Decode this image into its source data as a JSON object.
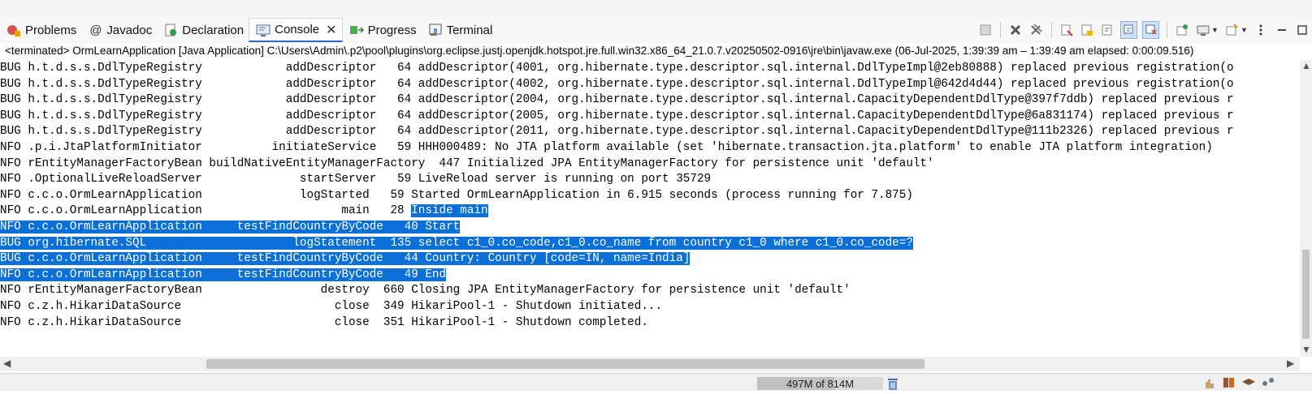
{
  "tabs": [
    {
      "label": "Problems",
      "icon": "problems-icon",
      "active": false
    },
    {
      "label": "Javadoc",
      "icon": "at-sign-icon",
      "active": false
    },
    {
      "label": "Declaration",
      "icon": "declaration-icon",
      "active": false
    },
    {
      "label": "Console",
      "icon": "console-icon",
      "active": true
    },
    {
      "label": "Progress",
      "icon": "progress-icon",
      "active": false
    },
    {
      "label": "Terminal",
      "icon": "terminal-icon",
      "active": false
    }
  ],
  "console_close": "✕",
  "description": "<terminated> OrmLearnApplication [Java Application] C:\\Users\\Admin\\.p2\\pool\\plugins\\org.eclipse.justj.openjdk.hotspot.jre.full.win32.x86_64_21.0.7.v20250502-0916\\jre\\bin\\javaw.exe  (06-Jul-2025, 1:39:39 am – 1:39:49 am elapsed: 0:00:09.516)",
  "lines": [
    {
      "text": "BUG h.t.d.s.s.DdlTypeRegistry            addDescriptor   64 addDescriptor(4001, org.hibernate.type.descriptor.sql.internal.DdlTypeImpl@2eb80888) replaced previous registration(o",
      "selected": false,
      "sel": ""
    },
    {
      "text": "BUG h.t.d.s.s.DdlTypeRegistry            addDescriptor   64 addDescriptor(4002, org.hibernate.type.descriptor.sql.internal.DdlTypeImpl@642d4d44) replaced previous registration(o",
      "selected": false,
      "sel": ""
    },
    {
      "text": "BUG h.t.d.s.s.DdlTypeRegistry            addDescriptor   64 addDescriptor(2004, org.hibernate.type.descriptor.sql.internal.CapacityDependentDdlType@397f7ddb) replaced previous r",
      "selected": false,
      "sel": ""
    },
    {
      "text": "BUG h.t.d.s.s.DdlTypeRegistry            addDescriptor   64 addDescriptor(2005, org.hibernate.type.descriptor.sql.internal.CapacityDependentDdlType@6a831174) replaced previous r",
      "selected": false,
      "sel": ""
    },
    {
      "text": "BUG h.t.d.s.s.DdlTypeRegistry            addDescriptor   64 addDescriptor(2011, org.hibernate.type.descriptor.sql.internal.CapacityDependentDdlType@111b2326) replaced previous r",
      "selected": false,
      "sel": ""
    },
    {
      "text": "NFO .p.i.JtaPlatformInitiator          initiateService   59 HHH000489: No JTA platform available (set 'hibernate.transaction.jta.platform' to enable JTA platform integration)",
      "selected": false,
      "sel": ""
    },
    {
      "text": "NFO rEntityManagerFactoryBean buildNativeEntityManagerFactory  447 Initialized JPA EntityManagerFactory for persistence unit 'default'",
      "selected": false,
      "sel": ""
    },
    {
      "text": "NFO .OptionalLiveReloadServer              startServer   59 LiveReload server is running on port 35729",
      "selected": false,
      "sel": ""
    },
    {
      "text": "NFO c.c.o.OrmLearnApplication              logStarted   59 Started OrmLearnApplication in 6.915 seconds (process running for 7.875)",
      "selected": false,
      "sel": ""
    },
    {
      "text": "NFO c.c.o.OrmLearnApplication                    main   28 ",
      "selected": false,
      "sel": "Inside main"
    },
    {
      "text": "",
      "selected": true,
      "sel": "NFO c.c.o.OrmLearnApplication     testFindCountryByCode   40 Start"
    },
    {
      "text": "",
      "selected": true,
      "sel": "BUG org.hibernate.SQL                     logStatement  135 select c1_0.co_code,c1_0.co_name from country c1_0 where c1_0.co_code=?"
    },
    {
      "text": "",
      "selected": true,
      "sel": "BUG c.c.o.OrmLearnApplication     testFindCountryByCode   44 Country: Country [code=IN, name=India]"
    },
    {
      "text": "",
      "selected": true,
      "sel": "NFO c.c.o.OrmLearnApplication     testFindCountryByCode   49 End"
    },
    {
      "text": "NFO rEntityManagerFactoryBean                 destroy  660 Closing JPA EntityManagerFactory for persistence unit 'default'",
      "selected": false,
      "sel": ""
    },
    {
      "text": "NFO c.z.h.HikariDataSource                      close  349 HikariPool-1 - Shutdown initiated...",
      "selected": false,
      "sel": ""
    },
    {
      "text": "NFO c.z.h.HikariDataSource                      close  351 HikariPool-1 - Shutdown completed.",
      "selected": false,
      "sel": ""
    }
  ],
  "heap": {
    "text": "497M of 814M",
    "fraction": 0.61
  },
  "colors": {
    "selection": "#0a6fd6",
    "active_tab_underline": "#2e66c8"
  }
}
